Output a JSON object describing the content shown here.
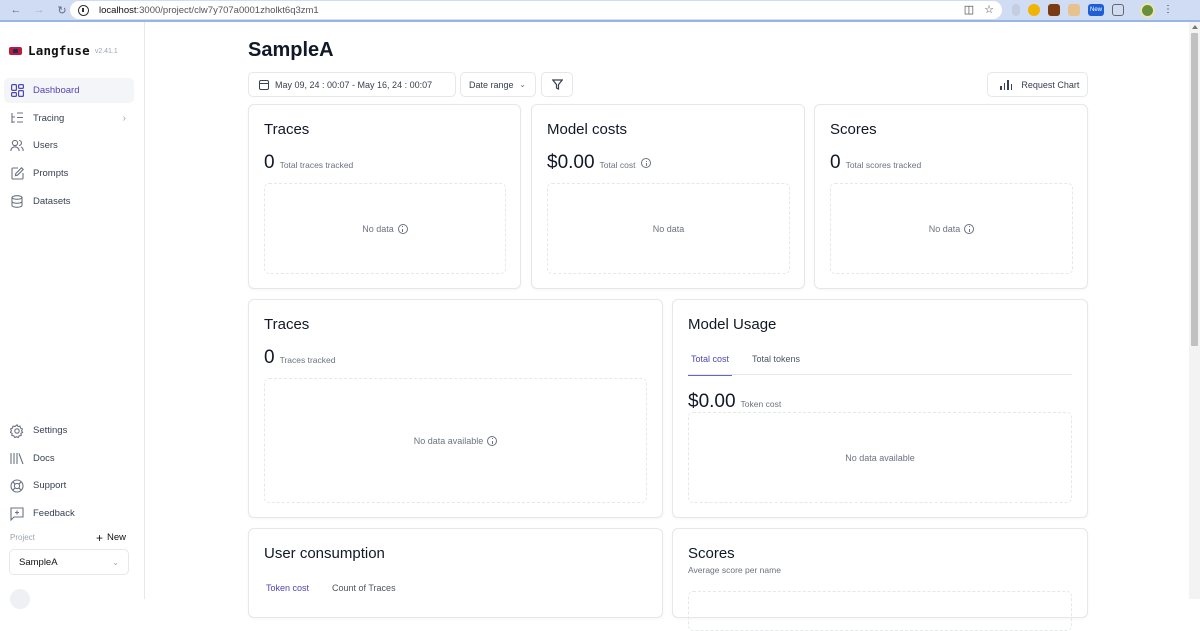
{
  "browser": {
    "url_host": "localhost",
    "url_path": ":3000/project/clw7y707a0001zholkt6q3zm1",
    "extension_badge": "New"
  },
  "sidebar": {
    "app_name": "Langfuse",
    "version": "v2.41.1",
    "nav": [
      {
        "label": "Dashboard",
        "icon": "dashboard-icon",
        "active": true
      },
      {
        "label": "Tracing",
        "icon": "tracing-icon",
        "has_submenu": true
      },
      {
        "label": "Users",
        "icon": "users-icon"
      },
      {
        "label": "Prompts",
        "icon": "prompts-icon"
      },
      {
        "label": "Datasets",
        "icon": "datasets-icon"
      }
    ],
    "bottom_nav": [
      {
        "label": "Settings",
        "icon": "gear-icon"
      },
      {
        "label": "Docs",
        "icon": "library-icon"
      },
      {
        "label": "Support",
        "icon": "lifebuoy-icon"
      },
      {
        "label": "Feedback",
        "icon": "feedback-icon"
      }
    ],
    "project_label": "Project",
    "new_label": "New",
    "project_selected": "SampleA"
  },
  "header": {
    "title": "SampleA",
    "date_range": "May 09, 24 : 00:07 - May 16, 24 : 00:07",
    "date_range_select": "Date range",
    "request_chart": "Request Chart"
  },
  "cards": {
    "traces_summary": {
      "title": "Traces",
      "value": "0",
      "label": "Total traces tracked",
      "empty": "No data"
    },
    "model_costs": {
      "title": "Model costs",
      "value": "$0.00",
      "label": "Total cost",
      "empty": "No data"
    },
    "scores_summary": {
      "title": "Scores",
      "value": "0",
      "label": "Total scores tracked",
      "empty": "No data"
    },
    "traces_chart": {
      "title": "Traces",
      "value": "0",
      "label": "Traces tracked",
      "empty": "No data available"
    },
    "model_usage": {
      "title": "Model Usage",
      "tabs": [
        {
          "label": "Total cost",
          "active": true
        },
        {
          "label": "Total tokens",
          "active": false
        }
      ],
      "value": "$0.00",
      "label": "Token cost",
      "empty": "No data available"
    },
    "user_consumption": {
      "title": "User consumption",
      "tabs": [
        {
          "label": "Token cost",
          "active": true
        },
        {
          "label": "Count of Traces",
          "active": false
        }
      ]
    },
    "scores_chart": {
      "title": "Scores",
      "subtitle": "Average score per name"
    }
  },
  "colors": {
    "accent": "#4f46b5",
    "border": "#e5e7eb",
    "muted_text": "#6b7280"
  }
}
